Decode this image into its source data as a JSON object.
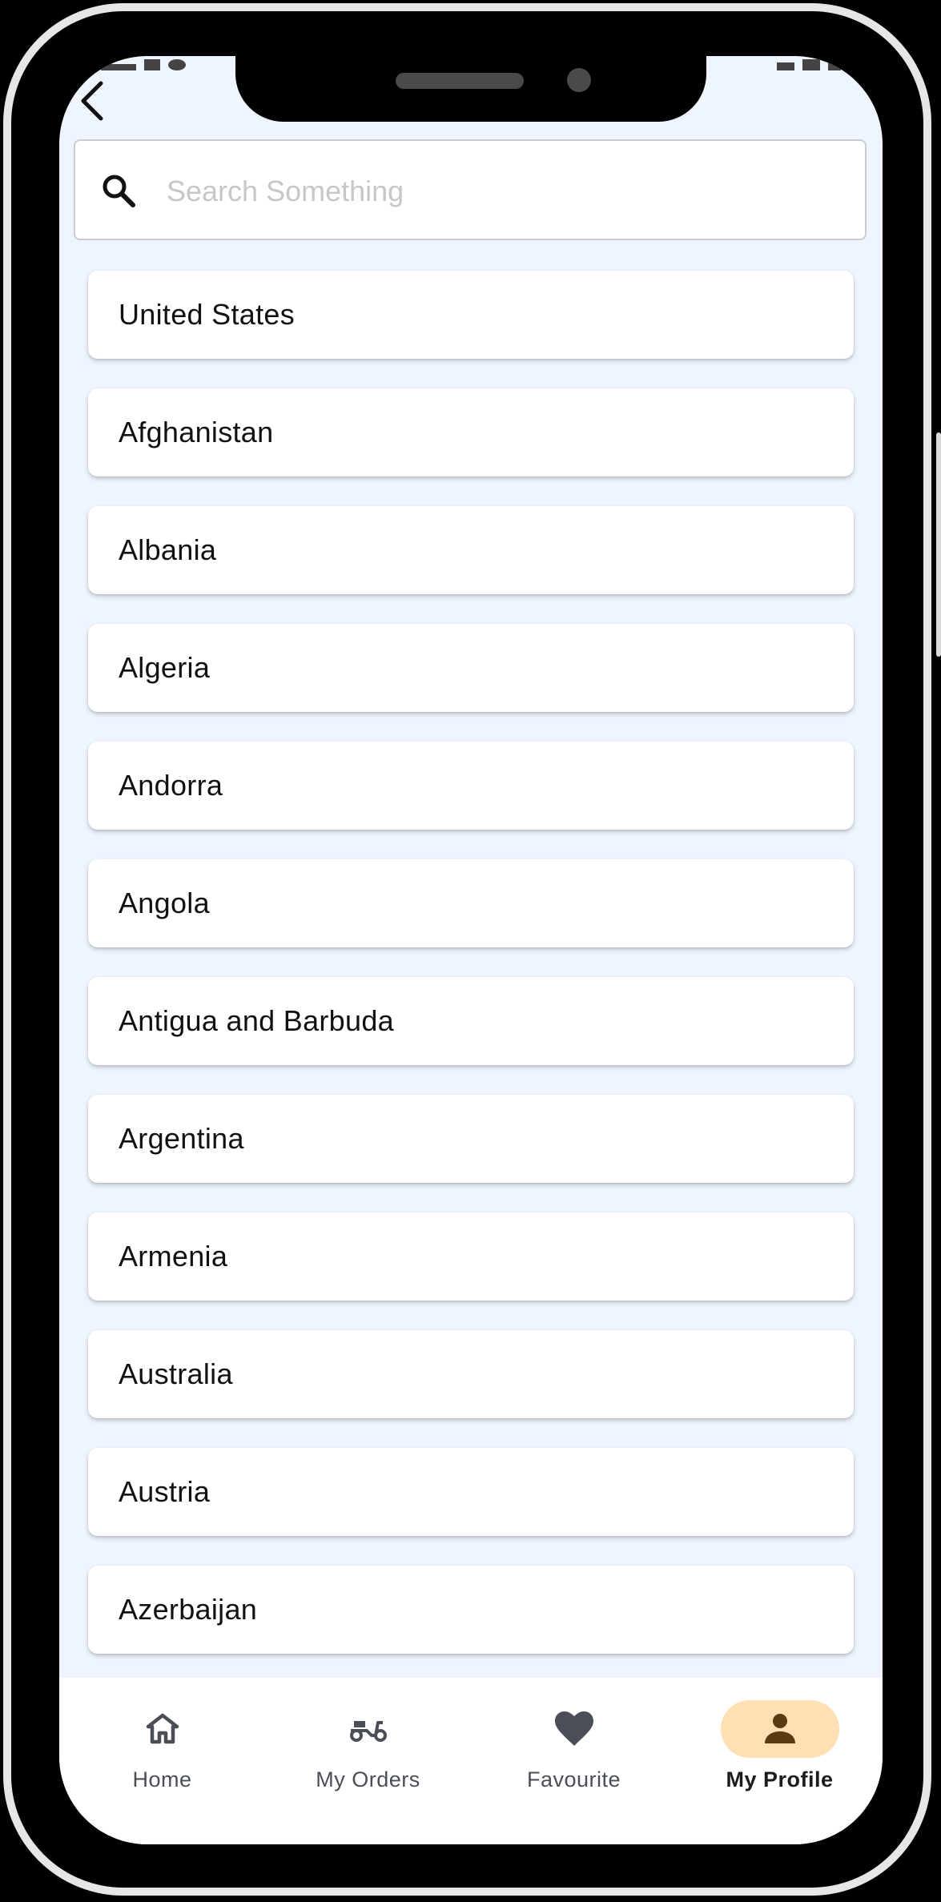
{
  "search": {
    "placeholder": "Search Something"
  },
  "countries": [
    "United States",
    "Afghanistan",
    "Albania",
    "Algeria",
    "Andorra",
    "Angola",
    "Antigua and Barbuda",
    "Argentina",
    "Armenia",
    "Australia",
    "Austria",
    "Azerbaijan"
  ],
  "bottom_nav": {
    "items": [
      {
        "label": "Home",
        "icon": "home-icon"
      },
      {
        "label": "My Orders",
        "icon": "scooter-icon"
      },
      {
        "label": "Favourite",
        "icon": "heart-icon"
      },
      {
        "label": "My Profile",
        "icon": "person-icon"
      }
    ],
    "active_index": 3
  },
  "colors": {
    "screen_bg": "#eef5fe",
    "active_pill": "#ffe0b3",
    "icon": "#4a4f57",
    "active_icon": "#5b3a12"
  }
}
